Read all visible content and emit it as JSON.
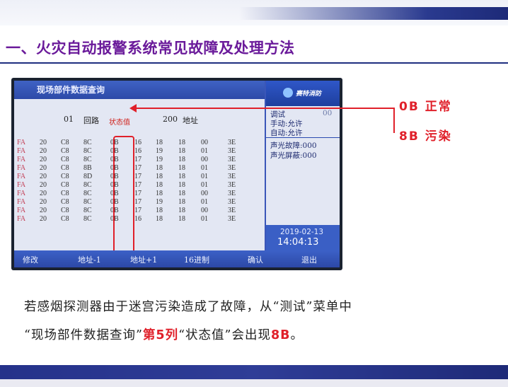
{
  "slide": {
    "title": "一、火灾自动报警系统常见故障及处理方法",
    "annotations": [
      "0B 正常",
      "8B 污染"
    ],
    "body_line1": "若感烟探测器由于迷宫污染造成了故障，从“测试”菜单中",
    "body_line2_a": "“现场部件数据查询”",
    "body_line2_b": "第5列",
    "body_line2_c": "“状态值”会出现",
    "body_line2_d": "8B",
    "body_line2_e": "。",
    "colors": {
      "title": "#6a1a9a",
      "annotation": "#e0202a",
      "band": "#1f2f80"
    }
  },
  "device": {
    "panel_title": "现场部件数据查询",
    "loop_no": "01",
    "loop_label": "回路",
    "status_label": "状态值",
    "address_no": "200",
    "address_label": "地址",
    "rows": [
      [
        "FA",
        "20",
        "C8",
        "8C",
        "0B",
        "16",
        "18",
        "18",
        "00",
        "3E"
      ],
      [
        "FA",
        "20",
        "C8",
        "8C",
        "0B",
        "16",
        "19",
        "18",
        "01",
        "3E"
      ],
      [
        "FA",
        "20",
        "C8",
        "8C",
        "0B",
        "17",
        "19",
        "18",
        "00",
        "3E"
      ],
      [
        "FA",
        "20",
        "C8",
        "8B",
        "0B",
        "17",
        "18",
        "18",
        "01",
        "3E"
      ],
      [
        "FA",
        "20",
        "C8",
        "8D",
        "0B",
        "17",
        "18",
        "18",
        "01",
        "3E"
      ],
      [
        "FA",
        "20",
        "C8",
        "8C",
        "0B",
        "17",
        "18",
        "18",
        "01",
        "3E"
      ],
      [
        "FA",
        "20",
        "C8",
        "8C",
        "0B",
        "17",
        "18",
        "18",
        "00",
        "3E"
      ],
      [
        "FA",
        "20",
        "C8",
        "8C",
        "0B",
        "17",
        "19",
        "18",
        "01",
        "3E"
      ],
      [
        "FA",
        "20",
        "C8",
        "8C",
        "0B",
        "17",
        "18",
        "18",
        "00",
        "3E"
      ],
      [
        "FA",
        "20",
        "C8",
        "8C",
        "0B",
        "16",
        "18",
        "18",
        "01",
        "3E"
      ]
    ],
    "side": {
      "logo": "赛特消防",
      "mode": "调试",
      "mode_code": "00",
      "manual": "手动:允许",
      "auto": "自动:允许",
      "sound_fault": "声光故障:000",
      "sound_shield": "声光屏蔽:000",
      "date": "2019-02-13",
      "time": "14:04:13"
    },
    "softkeys": [
      "修改",
      "地址-1",
      "地址+1",
      "16进制",
      "确认",
      "退出"
    ]
  }
}
